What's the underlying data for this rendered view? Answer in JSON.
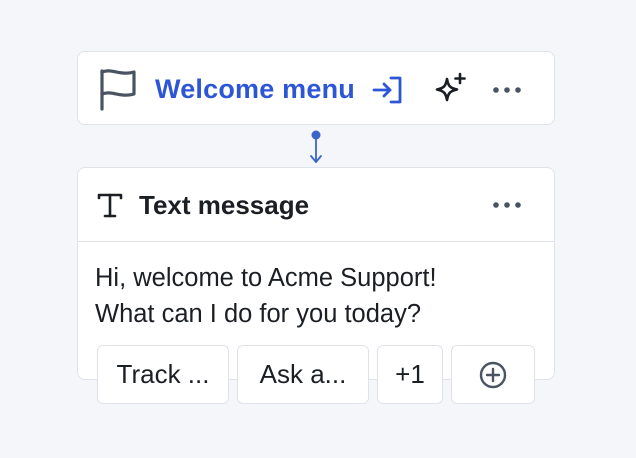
{
  "welcome_card": {
    "title": "Welcome menu",
    "icons": {
      "leading": "flag-icon",
      "go_to": "enter-icon",
      "ai": "sparkle-icon",
      "more": "more-horizontal-icon"
    }
  },
  "connector": {
    "icon": "arrow-down-connector"
  },
  "text_card": {
    "title": "Text message",
    "icons": {
      "leading": "text-type-icon",
      "more": "more-horizontal-icon"
    },
    "message_lines": [
      "Hi, welcome to Acme Support!",
      "What can I do for you today?"
    ]
  },
  "quick_replies": {
    "buttons": [
      {
        "label": "Track ..."
      },
      {
        "label": "Ask a..."
      },
      {
        "label": "+1"
      }
    ],
    "add_icon": "plus-circle-icon"
  },
  "colors": {
    "background": "#f4f6f9",
    "card_border": "#dfe3e9",
    "accent_blue": "#2d56d6",
    "connector_blue": "#3a66c9",
    "text_primary": "#1b1f24",
    "icon_gray": "#4a5361"
  }
}
